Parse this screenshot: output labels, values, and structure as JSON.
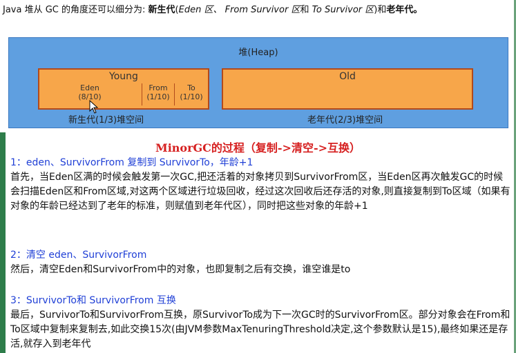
{
  "intro": {
    "p1": "Java 堆从 GC 的角度还可以细分为: ",
    "bold1": "新生代",
    "p2": "(",
    "it1": "Eden 区、 From Survivor 区",
    "p3": "和 ",
    "it2": "To Survivor 区",
    "p4": ")和",
    "bold2": "老年代。"
  },
  "heap": {
    "title": "堆(Heap)",
    "young": {
      "title": "Young",
      "eden": "Eden",
      "eden_ratio": "(8/10)",
      "from": "From",
      "from_ratio": "(1/10)",
      "to": "To",
      "to_ratio": "(1/10)"
    },
    "old": {
      "title": "Old"
    },
    "young_caption": "新生代(1/3)堆空间",
    "old_caption": "老年代(2/3)堆空间"
  },
  "section_title": "MinorGC的过程（复制->清空->互换）",
  "step1": {
    "heading": "1：eden、SurvivorFrom 复制到 SurvivorTo，年龄+1",
    "text": "首先，当Eden区满的时候会触发第一次GC,把还活着的对象拷贝到SurvivorFrom区，当Eden区再次触发GC的时候会扫描Eden区和From区域,对这两个区域进行垃圾回收，经过这次回收后还存活的对象,则直接复制到To区域（如果有对象的年龄已经达到了老年的标准，则赋值到老年代区），同时把这些对象的年龄+1"
  },
  "step2": {
    "heading": "2：清空 eden、SurvivorFrom",
    "text": "然后，清空Eden和SurvivorFrom中的对象，也即复制之后有交换，谁空谁是to"
  },
  "step3": {
    "heading": "3：SurvivorTo和 SurvivorFrom 互换",
    "text": "最后，SurvivorTo和SurvivorFrom互换，原SurvivorTo成为下一次GC时的SurvivorFrom区。部分对象会在From和To区域中复制来复制去,如此交换15次(由JVM参数MaxTenuringThreshold决定,这个参数默认是15),最终如果还是存活,就存入到老年代"
  },
  "colors": {
    "heap_bg": "#5f9fe0",
    "region_bg": "#f7a64a",
    "region_border": "#b24a1c",
    "title_red": "#d62020",
    "step_blue": "#1f3fd6"
  }
}
